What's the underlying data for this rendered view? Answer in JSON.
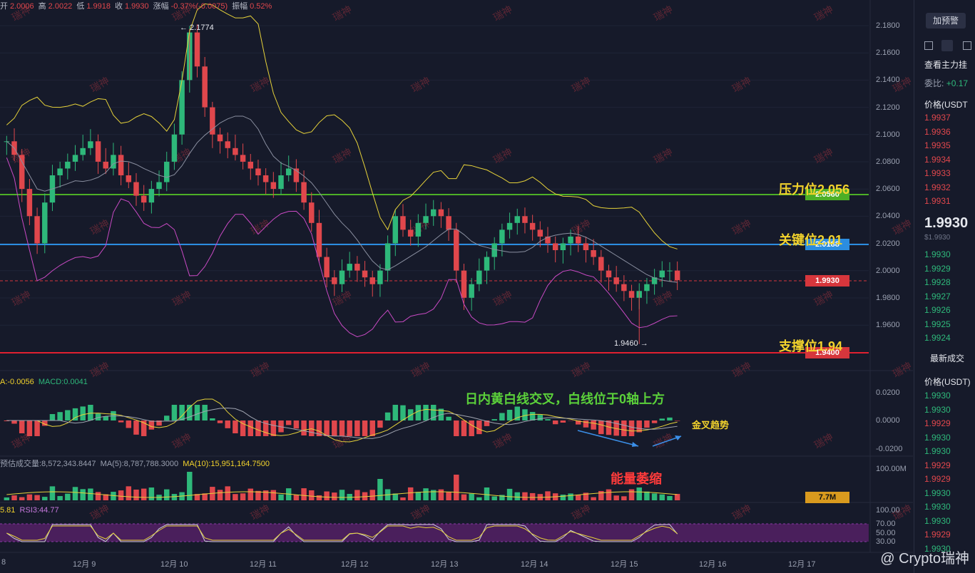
{
  "header": {
    "items": [
      {
        "label": "开",
        "value": "2.0006"
      },
      {
        "label": "高",
        "value": "2.0022"
      },
      {
        "label": "低",
        "value": "1.9918"
      },
      {
        "label": "收",
        "value": "1.9930"
      },
      {
        "label": "涨幅",
        "value": "-0.37%(-0.0075)"
      },
      {
        "label": "振幅",
        "value": "0.52%"
      }
    ]
  },
  "watermark_text": "瑞神",
  "price_axis": {
    "ticks": [
      "2.1800",
      "2.1600",
      "2.1400",
      "2.1200",
      "2.1000",
      "2.0800",
      "2.0600",
      "2.0400",
      "2.0200",
      "2.0000",
      "1.9800",
      "1.9600"
    ]
  },
  "tags": {
    "resistance": {
      "value": "2.0560",
      "color": "#4caf26"
    },
    "key": {
      "value": "2.0188",
      "color": "#2b8de0"
    },
    "current": {
      "value": "1.9930",
      "color": "#d6363c"
    },
    "support": {
      "value": "1.9400",
      "color": "#d6363c"
    },
    "volume": {
      "value": "7.7M",
      "color": "#d99a1e"
    }
  },
  "annotations": {
    "resistance": "压力位2.056",
    "key": "关键位2.01",
    "support": "支撑位1.94",
    "macd_note": "日内黄白线交叉，白线位于0轴上方",
    "golden_cross": "金叉趋势",
    "volume_note": "能量萎缩",
    "high_marker": "← 2.1774",
    "low_marker": "1.9460 →"
  },
  "macd": {
    "label_a": "A:-0.0056",
    "label_b": "MACD:0.0041",
    "ticks": [
      "0.0200",
      "0.0000",
      "-0.0200"
    ]
  },
  "volume": {
    "label_a": "预估成交量:8,572,343.8447",
    "label_b": "MA(5):8,787,788.3000",
    "label_c": "MA(10):15,951,164.7500",
    "ticks": [
      "100.00M"
    ]
  },
  "rsi": {
    "label_a": "5.81",
    "label_b": "RSI3:44.77",
    "ticks": [
      "100.00",
      "70.00",
      "50.00",
      "30.00"
    ]
  },
  "x_axis": {
    "labels": [
      "8",
      "12月 9",
      "12月 10",
      "12月 11",
      "12月 12",
      "12月 13",
      "12月 14",
      "12月 15",
      "12月 16",
      "12月 17"
    ]
  },
  "orderbook": {
    "top_red": "",
    "alert_button": "加预警",
    "title": "查看主力挂",
    "ratio_label": "委比:",
    "ratio_value": "+0.17",
    "price_header": "价格(USDT",
    "asks": [
      "1.9937",
      "1.9936",
      "1.9935",
      "1.9934",
      "1.9933",
      "1.9932",
      "1.9931"
    ],
    "last_price": "1.9930",
    "last_price_sub": "$1.9930",
    "bids": [
      "1.9930",
      "1.9929",
      "1.9928",
      "1.9927",
      "1.9926",
      "1.9925",
      "1.9924"
    ],
    "trades_title": "最新成交",
    "trades_header": "价格(USDT)",
    "trades": [
      {
        "p": "1.9930",
        "c": "green"
      },
      {
        "p": "1.9930",
        "c": "green"
      },
      {
        "p": "1.9929",
        "c": "red"
      },
      {
        "p": "1.9930",
        "c": "green"
      },
      {
        "p": "1.9930",
        "c": "green"
      },
      {
        "p": "1.9929",
        "c": "red"
      },
      {
        "p": "1.9929",
        "c": "red"
      },
      {
        "p": "1.9930",
        "c": "green"
      },
      {
        "p": "1.9930",
        "c": "green"
      },
      {
        "p": "1.9930",
        "c": "green"
      },
      {
        "p": "1.9929",
        "c": "red"
      },
      {
        "p": "1.9930",
        "c": "green"
      }
    ]
  },
  "footer": {
    "brand": "@ Crypto瑞神"
  },
  "chart_data": {
    "type": "candlestick",
    "series": [
      {
        "name": "price",
        "points": [
          [
            0,
            2.095
          ],
          [
            1,
            2.085
          ],
          [
            2,
            2.06
          ],
          [
            3,
            2.04
          ],
          [
            4,
            2.02
          ],
          [
            5,
            2.05
          ],
          [
            6,
            2.07
          ],
          [
            7,
            2.075
          ],
          [
            8,
            2.08
          ],
          [
            9,
            2.085
          ],
          [
            10,
            2.09
          ],
          [
            11,
            2.095
          ],
          [
            12,
            2.08
          ],
          [
            13,
            2.075
          ],
          [
            14,
            2.085
          ],
          [
            15,
            2.07
          ],
          [
            16,
            2.065
          ],
          [
            17,
            2.055
          ],
          [
            18,
            2.05
          ],
          [
            19,
            2.06
          ],
          [
            20,
            2.065
          ],
          [
            21,
            2.08
          ],
          [
            22,
            2.1
          ],
          [
            23,
            2.14
          ],
          [
            24,
            2.175
          ],
          [
            25,
            2.15
          ],
          [
            26,
            2.12
          ],
          [
            27,
            2.1
          ],
          [
            28,
            2.095
          ],
          [
            29,
            2.09
          ],
          [
            30,
            2.085
          ],
          [
            31,
            2.08
          ],
          [
            32,
            2.075
          ],
          [
            33,
            2.07
          ],
          [
            34,
            2.065
          ],
          [
            35,
            2.06
          ],
          [
            36,
            2.07
          ],
          [
            37,
            2.075
          ],
          [
            38,
            2.065
          ],
          [
            39,
            2.05
          ],
          [
            40,
            2.035
          ],
          [
            41,
            2.01
          ],
          [
            42,
            1.995
          ],
          [
            43,
            1.99
          ],
          [
            44,
            2.0
          ],
          [
            45,
            2.005
          ],
          [
            46,
            2.0
          ],
          [
            47,
            1.995
          ],
          [
            48,
            1.99
          ],
          [
            49,
            2.0
          ],
          [
            50,
            2.02
          ],
          [
            51,
            2.04
          ],
          [
            52,
            2.03
          ],
          [
            53,
            2.025
          ],
          [
            54,
            2.035
          ],
          [
            55,
            2.04
          ],
          [
            56,
            2.045
          ],
          [
            57,
            2.04
          ],
          [
            58,
            2.03
          ],
          [
            59,
            2.0
          ],
          [
            60,
            1.98
          ],
          [
            61,
            1.99
          ],
          [
            62,
            2.0
          ],
          [
            63,
            2.01
          ],
          [
            64,
            2.02
          ],
          [
            65,
            2.03
          ],
          [
            66,
            2.035
          ],
          [
            67,
            2.04
          ],
          [
            68,
            2.035
          ],
          [
            69,
            2.03
          ],
          [
            70,
            2.025
          ],
          [
            71,
            2.02
          ],
          [
            72,
            2.015
          ],
          [
            73,
            2.02
          ],
          [
            74,
            2.025
          ],
          [
            75,
            2.02
          ],
          [
            76,
            2.015
          ],
          [
            77,
            2.01
          ],
          [
            78,
            2.0
          ],
          [
            79,
            1.995
          ],
          [
            80,
            1.99
          ],
          [
            81,
            1.985
          ],
          [
            82,
            1.98
          ],
          [
            83,
            1.985
          ],
          [
            84,
            1.99
          ],
          [
            85,
            1.995
          ],
          [
            86,
            2.0
          ],
          [
            87,
            2.0
          ],
          [
            88,
            1.993
          ]
        ]
      }
    ],
    "high": 2.1774,
    "low": 1.946,
    "levels": {
      "resistance": 2.056,
      "key": 2.0188,
      "current": 1.993,
      "support": 1.94
    },
    "ylim": [
      1.94,
      2.19
    ],
    "xlabel": "",
    "ylabel": ""
  }
}
